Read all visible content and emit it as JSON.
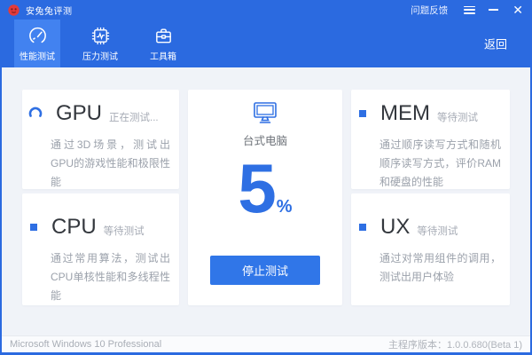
{
  "titlebar": {
    "app_title": "安兔兔评测",
    "feedback_label": "问题反馈"
  },
  "nav": {
    "tabs": [
      {
        "label": "性能测试",
        "icon": "gauge-icon",
        "selected": true
      },
      {
        "label": "压力测试",
        "icon": "chip-icon",
        "selected": false
      },
      {
        "label": "工具箱",
        "icon": "toolbox-icon",
        "selected": false
      }
    ],
    "back_label": "返回"
  },
  "cards": {
    "gpu": {
      "title": "GPU",
      "status": "正在测试...",
      "description": "通过3D场景，测试出GPU的游戏性能和极限性能",
      "icon": "loading-spinner-icon"
    },
    "cpu": {
      "title": "CPU",
      "status": "等待测试",
      "description": "通过常用算法，测试出CPU单核性能和多线程性能",
      "icon": "square-bullet"
    },
    "mem": {
      "title": "MEM",
      "status": "等待测试",
      "description": "通过顺序读写方式和随机顺序读写方式，评价RAM和硬盘的性能",
      "icon": "square-bullet"
    },
    "ux": {
      "title": "UX",
      "status": "等待测试",
      "description": "通过对常用组件的调用，测试出用户体验",
      "icon": "square-bullet"
    }
  },
  "center": {
    "device_label": "台式电脑",
    "device_icon": "desktop-monitor-icon",
    "progress_percent": "5",
    "percent_sign": "%",
    "stop_button_label": "停止测试"
  },
  "footer": {
    "os_text": "Microsoft Windows 10 Professional",
    "version_text": "主程序版本：1.0.0.680(Beta 1)"
  },
  "colors": {
    "header_blue": "#2b6ae0",
    "selected_tab_blue": "#4282f0",
    "accent_blue": "#2e6fe3",
    "button_blue": "#3076e8",
    "content_background": "#f0f3f8",
    "logo_red": "#e23b3b"
  }
}
